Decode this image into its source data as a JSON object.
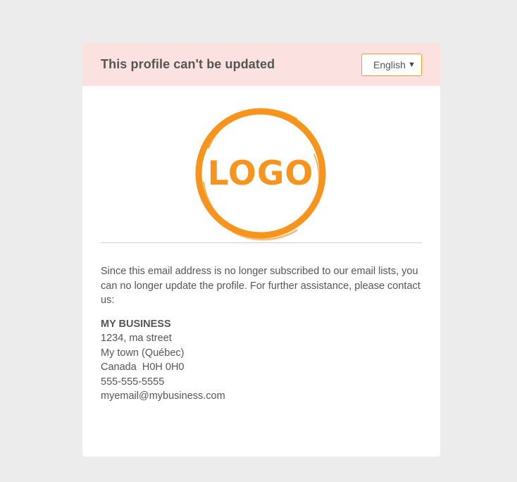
{
  "header": {
    "title": "This profile can't be updated",
    "language": {
      "selected": "English",
      "caret": "▼"
    }
  },
  "logo": {
    "text": "LOGO",
    "color": "#f7941d"
  },
  "message": "Since this email address is no longer subscribed to our email lists, you can no longer update the profile. For further assistance, please contact us:",
  "contact": {
    "name": "MY BUSINESS",
    "street": "1234, ma street",
    "city": "My town (Québec)",
    "country_postal": "Canada  H0H 0H0",
    "phone": "555-555-5555",
    "email": "myemail@mybusiness.com"
  },
  "colors": {
    "page_bg": "#ececec",
    "header_bg": "#fce1e1",
    "accent": "#f39c2c",
    "text": "#555555"
  }
}
